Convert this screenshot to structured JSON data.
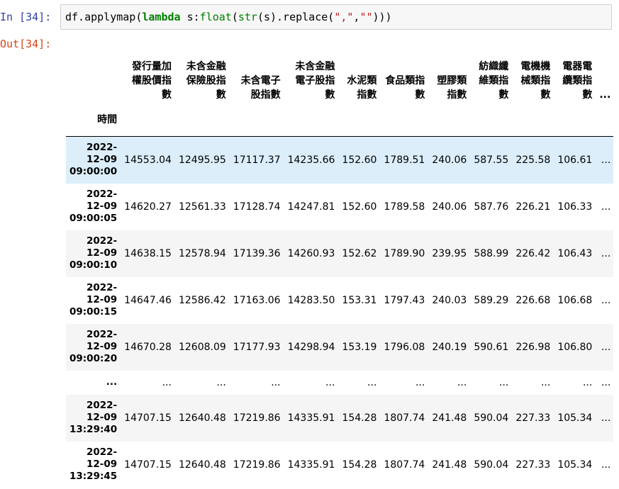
{
  "cell": {
    "in_prompt": "In [34]:",
    "out_prompt": "Out[34]:",
    "code": {
      "t1": "df.applymap(",
      "t2": "lambda",
      "t3": " s:",
      "t4": "float",
      "t5": "(",
      "t6": "str",
      "t7": "(s).replace(",
      "t8": "\",\"",
      "t9": ",",
      "t10": "\"\"",
      "t11": ")))"
    }
  },
  "table": {
    "index_name": "時間",
    "columns": [
      "發行量加權股價指數",
      "未含金融保險股指數",
      "未含電子股指數",
      "未含金融電子股指數",
      "水泥類指數",
      "食品類指數",
      "塑膠類指數",
      "紡織纖維類指數",
      "電機機械類指數",
      "電器電纜類指數",
      "..."
    ],
    "rows": [
      {
        "index": "2022-12-09 09:00:00",
        "values": [
          "14553.04",
          "12495.95",
          "17117.37",
          "14235.66",
          "152.60",
          "1789.51",
          "240.06",
          "587.55",
          "225.58",
          "106.61",
          "..."
        ]
      },
      {
        "index": "2022-12-09 09:00:05",
        "values": [
          "14620.27",
          "12561.33",
          "17128.74",
          "14247.81",
          "152.60",
          "1789.58",
          "240.06",
          "587.76",
          "226.21",
          "106.33",
          "..."
        ]
      },
      {
        "index": "2022-12-09 09:00:10",
        "values": [
          "14638.15",
          "12578.94",
          "17139.36",
          "14260.93",
          "152.62",
          "1789.90",
          "239.95",
          "588.99",
          "226.42",
          "106.43",
          "..."
        ]
      },
      {
        "index": "2022-12-09 09:00:15",
        "values": [
          "14647.46",
          "12586.42",
          "17163.06",
          "14283.50",
          "153.31",
          "1797.43",
          "240.03",
          "589.29",
          "226.68",
          "106.68",
          "..."
        ]
      },
      {
        "index": "2022-12-09 09:00:20",
        "values": [
          "14670.28",
          "12608.09",
          "17177.93",
          "14298.94",
          "153.19",
          "1796.08",
          "240.19",
          "590.61",
          "226.98",
          "106.80",
          "..."
        ]
      },
      {
        "index": "...",
        "values": [
          "...",
          "...",
          "...",
          "...",
          "...",
          "...",
          "...",
          "...",
          "...",
          "...",
          "..."
        ]
      },
      {
        "index": "2022-12-09 13:29:40",
        "values": [
          "14707.15",
          "12640.48",
          "17219.86",
          "14335.91",
          "154.28",
          "1807.74",
          "241.48",
          "590.04",
          "227.33",
          "105.34",
          "..."
        ]
      },
      {
        "index": "2022-12-09 13:29:45",
        "values": [
          "14707.15",
          "12640.48",
          "17219.86",
          "14335.91",
          "154.28",
          "1807.74",
          "241.48",
          "590.04",
          "227.33",
          "105.34",
          "..."
        ]
      }
    ]
  }
}
